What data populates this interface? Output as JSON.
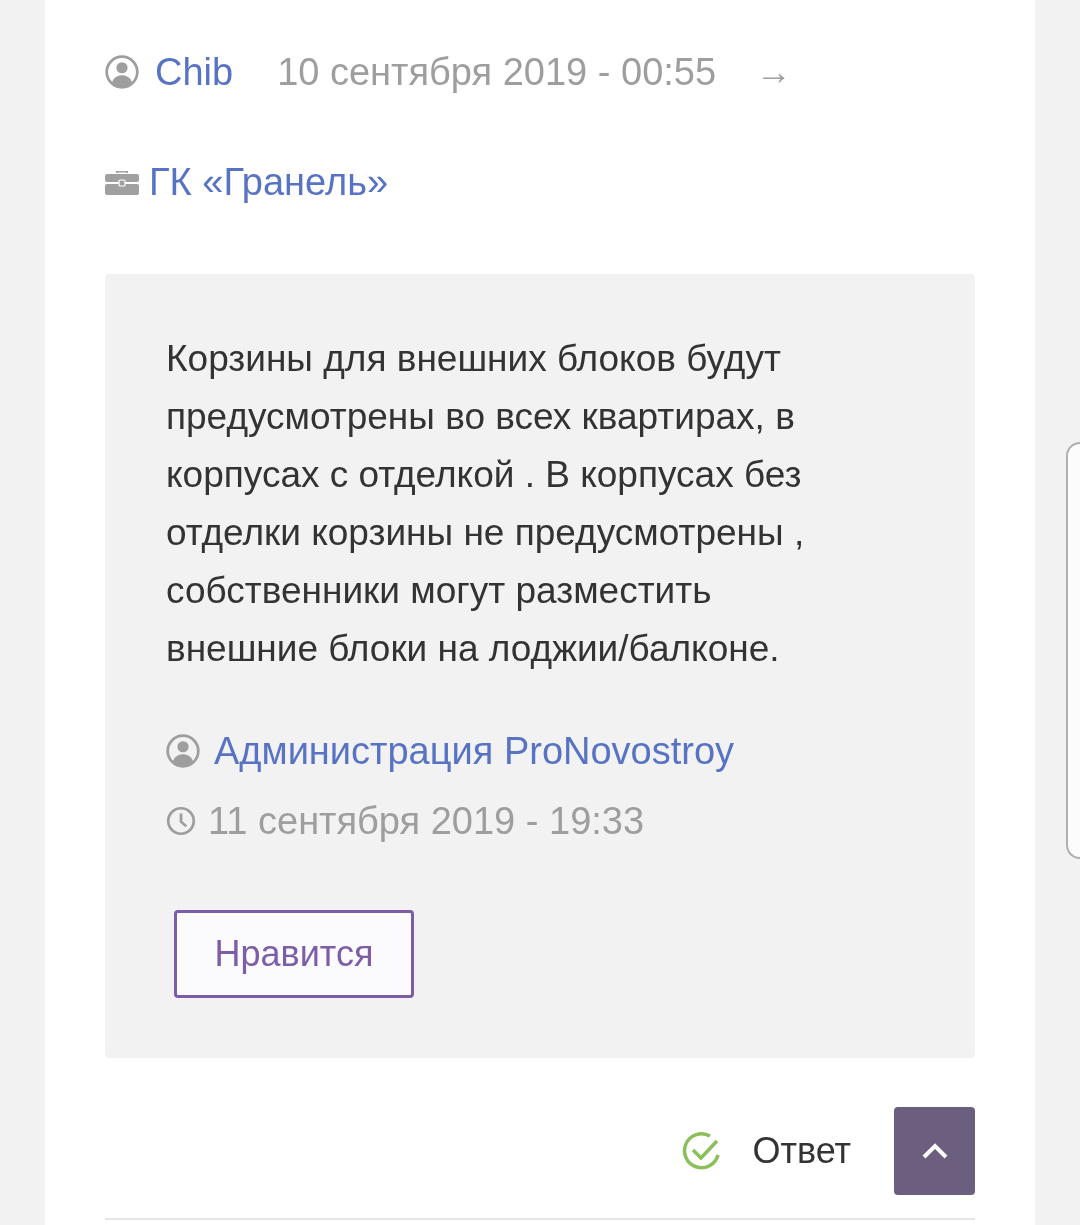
{
  "comment_meta": {
    "author": "Chib",
    "date": "10 сентября 2019 - 00:55",
    "arrow": "→"
  },
  "company": {
    "name": "ГК «Гранель»"
  },
  "reply": {
    "text": "Корзины для внешних блоков будут предусмотрены во всех квартирах, в корпусах с отделкой . В корпусах без отделки корзины не предусмотрены , собственники могут разместить внешние блоки на лоджии/балконе.",
    "author": "Администрация ProNovostroy",
    "date": "11 сентября 2019 - 19:33",
    "like_button": "Нравится"
  },
  "answer": {
    "label": "Ответ",
    "checked": true
  }
}
